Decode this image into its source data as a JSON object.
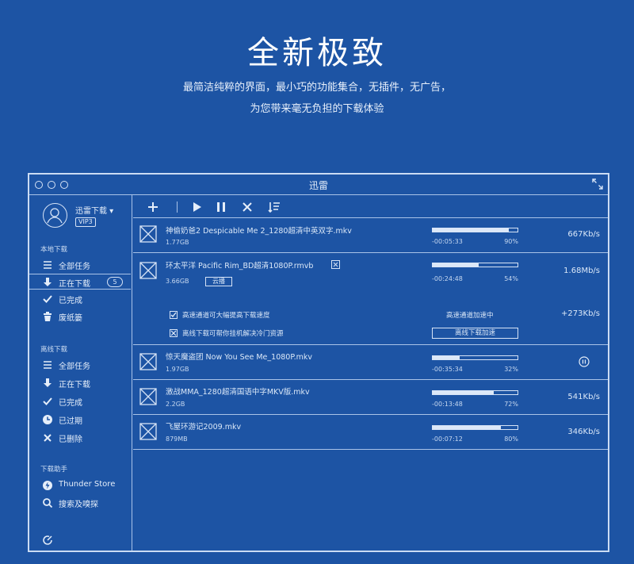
{
  "hero": {
    "title": "全新极致",
    "subtitle_line1": "最简洁纯粹的界面，最小巧的功能集合，无插件，无广告，",
    "subtitle_line2": "为您带来毫无负担的下载体验"
  },
  "window": {
    "title": "迅雷"
  },
  "user": {
    "name": "迅雷下载 ▾",
    "badge": "VIP3"
  },
  "sidebar": {
    "local_section": "本地下载",
    "local_items": [
      {
        "label": "全部任务",
        "icon": "list-icon"
      },
      {
        "label": "正在下载",
        "icon": "download-arrow-icon",
        "count": "5"
      },
      {
        "label": "已完成",
        "icon": "checkmark-icon"
      },
      {
        "label": "废纸篓",
        "icon": "trash-icon"
      }
    ],
    "offline_section": "离线下载",
    "offline_items": [
      {
        "label": "全部任务",
        "icon": "list-icon"
      },
      {
        "label": "正在下载",
        "icon": "download-arrow-icon"
      },
      {
        "label": "已完成",
        "icon": "checkmark-icon"
      },
      {
        "label": "已过期",
        "icon": "clock-icon"
      },
      {
        "label": "已删除",
        "icon": "close-icon"
      }
    ],
    "helper_section": "下载助手",
    "helper_items": [
      {
        "label": "Thunder Store",
        "icon": "thunder-store-icon"
      },
      {
        "label": "搜索及嗅探",
        "icon": "search-icon"
      }
    ]
  },
  "toolbar": {
    "buttons": [
      "add-icon",
      "play-icon",
      "pause-icon",
      "delete-icon",
      "sort-icon"
    ]
  },
  "tasks": [
    {
      "name": "神偷奶爸2 Despicable Me 2_1280超清中英双字.mkv",
      "size": "1.77GB",
      "elapsed": "-00:05:33",
      "percent": "90%",
      "progress": 0.9,
      "speed": "667Kb/s"
    },
    {
      "name": "环太平洋 Pacific Rim_BD超清1080P.rmvb",
      "size": "3.66GB",
      "cloud_label": "云播",
      "elapsed": "-00:24:48",
      "percent": "54%",
      "progress": 0.54,
      "speed": "1.68Mb/s",
      "options": [
        {
          "label": "高速通道可大幅提高下载速度",
          "status": "高速通道加速中",
          "extra_speed": "+273Kb/s"
        },
        {
          "label": "离线下载可帮你挂机解决冷门资源",
          "button": "离线下载加速"
        }
      ]
    },
    {
      "name": "惊天魔盗团 Now You See Me_1080P.mkv",
      "size": "1.97GB",
      "elapsed": "-00:35:34",
      "percent": "32%",
      "progress": 0.32,
      "state": "paused"
    },
    {
      "name": "激战MMA_1280超清国语中字MKV版.mkv",
      "size": "2.2GB",
      "elapsed": "-00:13:48",
      "percent": "72%",
      "progress": 0.72,
      "speed": "541Kb/s"
    },
    {
      "name": "飞屋环游记2009.mkv",
      "size": "879MB",
      "elapsed": "-00:07:12",
      "percent": "80%",
      "progress": 0.8,
      "speed": "346Kb/s"
    }
  ]
}
